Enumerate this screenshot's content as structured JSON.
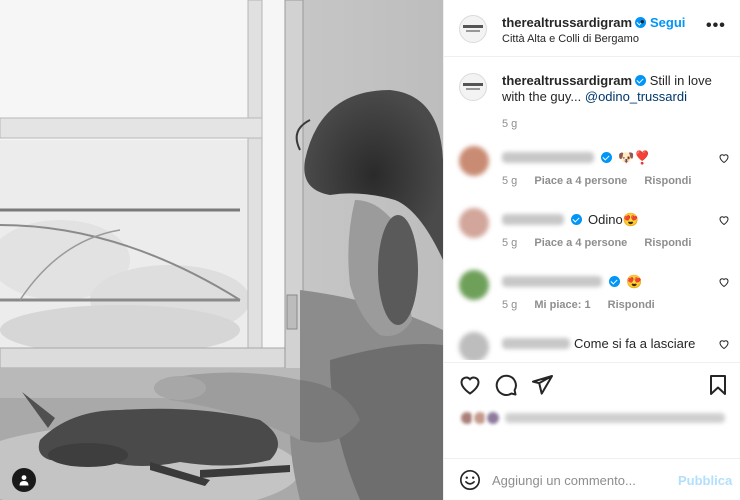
{
  "post": {
    "username": "therealtrussardigram",
    "follow_label": "Segui",
    "separator": "•",
    "location": "Città Alta e Colli di Bergamo",
    "more_label": "•••"
  },
  "caption": {
    "username": "therealtrussardigram",
    "text": "Still in love with the guy...",
    "mention": "@odino_trussardi",
    "time": "5 g"
  },
  "comments": [
    {
      "text": "🐶❣️",
      "time": "5 g",
      "likes": "Piace a 4 persone",
      "reply": "Rispondi",
      "avatar_color": "#c98b73"
    },
    {
      "text": "Odino😍",
      "time": "5 g",
      "likes": "Piace a 4 persone",
      "reply": "Rispondi",
      "avatar_color": "#d2a69a"
    },
    {
      "text": "😍",
      "time": "5 g",
      "likes": "Mi piace: 1",
      "reply": "Rispondi",
      "avatar_color": "#6fa05a"
    },
    {
      "text": "Come si fa a lasciare",
      "time": "",
      "likes": "",
      "reply": "",
      "avatar_color": "#bdbdbd"
    }
  ],
  "actions": {
    "like_icon": "heart-outline",
    "comment_icon": "speech-bubble",
    "share_icon": "paper-plane",
    "save_icon": "bookmark"
  },
  "add_comment": {
    "placeholder": "Aggiungi un commento...",
    "post_label": "Pubblica",
    "emoji_icon": "smiley"
  },
  "colors": {
    "accent": "#0095f6",
    "muted": "#8e8e8e",
    "post_disabled": "#b2dffc",
    "heart_red": "#ed4956"
  }
}
